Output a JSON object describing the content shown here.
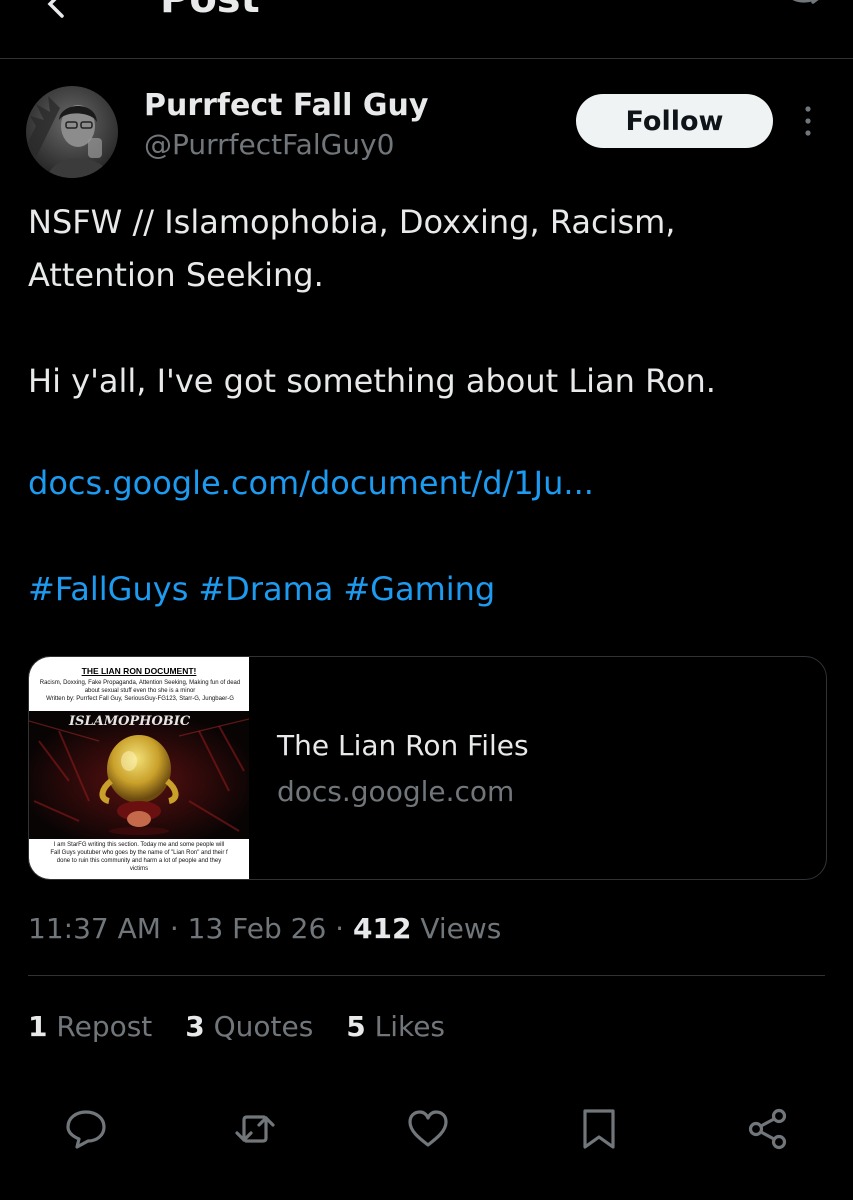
{
  "header": {
    "title": "Post"
  },
  "author": {
    "display_name": "Purrfect Fall Guy",
    "handle": "@PurrfectFalGuy0",
    "follow_label": "Follow"
  },
  "post": {
    "paragraphs": [
      "NSFW // Islamophobia, Doxxing, Racism, Attention Seeking.",
      "Hi y'all, I've got something about Lian Ron."
    ],
    "link_text": "docs.google.com/document/d/1Ju...",
    "hashtags": [
      "#FallGuys",
      "#Drama",
      "#Gaming"
    ]
  },
  "card": {
    "thumbnail": {
      "title": "THE LIAN RON DOCUMENT!",
      "line1": "Racism, Doxxing, Fake Propaganda, Attention Seeking, Making fun of dead",
      "line2": "about sexual stuff even tho she is a minor",
      "line3": "Written by: Purrfect Fall Guy, SeriousGuy-FG123, Starr-G, Jungbaer-G",
      "banner": "ISLAMOPHOBIC",
      "caption1": "I am StarFG writing this section. Today me and some people will",
      "caption2": "Fall Guys youtuber who goes by the name of \"Lian Ron\" and their f",
      "caption3": "done to ruin this community and harm a lot of people and they",
      "caption4": "victims"
    },
    "title": "The Lian Ron Files",
    "domain": "docs.google.com"
  },
  "meta": {
    "time": "11:37 AM",
    "separator": "·",
    "date": "13 Feb 26",
    "views_count": "412",
    "views_label": "Views"
  },
  "stats": {
    "reposts_count": "1",
    "reposts_label": "Repost",
    "quotes_count": "3",
    "quotes_label": "Quotes",
    "likes_count": "5",
    "likes_label": "Likes"
  },
  "colors": {
    "background": "#000000",
    "text": "#e7e9ea",
    "secondary": "#71767b",
    "link": "#1d9bf0",
    "border": "#2f3336"
  },
  "icons": [
    "back-arrow-icon",
    "reply-icon",
    "more-vertical-icon",
    "comment-icon",
    "repost-icon",
    "heart-icon",
    "bookmark-icon",
    "share-icon"
  ]
}
